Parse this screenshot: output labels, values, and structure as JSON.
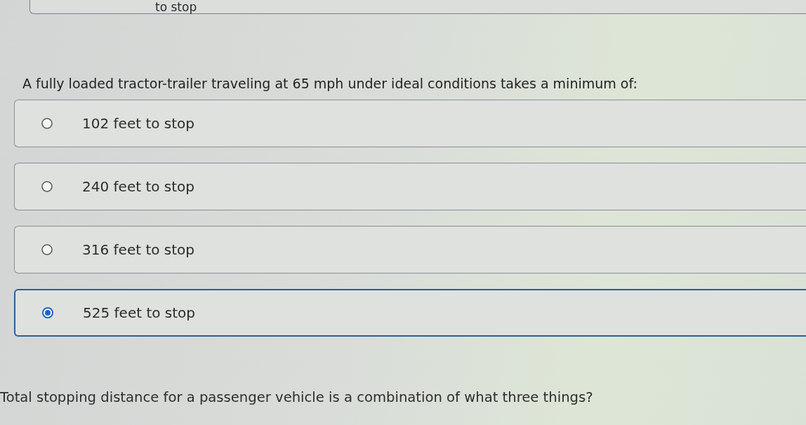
{
  "previous_option": {
    "label": "to stop"
  },
  "question": {
    "text": "A fully loaded tractor-trailer traveling at 65 mph under ideal conditions takes a minimum of:",
    "options": [
      {
        "label": "102 feet to stop",
        "selected": false
      },
      {
        "label": "240 feet to stop",
        "selected": false
      },
      {
        "label": "316 feet to stop",
        "selected": false
      },
      {
        "label": "525 feet to stop",
        "selected": true
      }
    ]
  },
  "next_question": {
    "text": "Total stopping distance for a passenger vehicle is a combination of what three things?"
  }
}
